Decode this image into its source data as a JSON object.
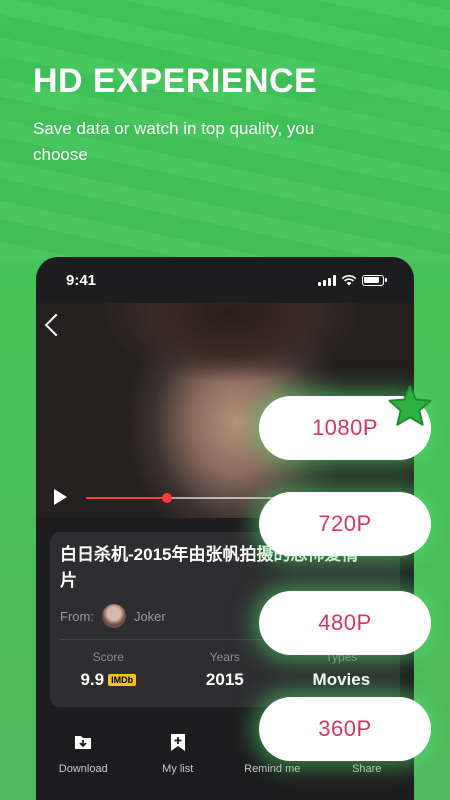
{
  "promo": {
    "headline": "HD EXPERIENCE",
    "subline": "Save data or watch in top quality, you choose"
  },
  "status_bar": {
    "time": "9:41"
  },
  "player": {
    "progress": 0.27
  },
  "movie": {
    "title": "白日杀机-2015年由张帆拍摄的恐怖爱情片",
    "from_label": "From:",
    "uploader": "Joker",
    "stats": [
      {
        "label": "Score",
        "value": "9.9",
        "badge": "IMDb"
      },
      {
        "label": "Years",
        "value": "2015"
      },
      {
        "label": "Types",
        "value": "Movies"
      }
    ]
  },
  "actions": [
    {
      "label": "Download",
      "icon": "download-icon"
    },
    {
      "label": "My list",
      "icon": "bookmark-add-icon"
    },
    {
      "label": "Remind me",
      "icon": "bell-icon"
    },
    {
      "label": "Share",
      "icon": "share-icon"
    }
  ],
  "quality_options": [
    "1080P",
    "720P",
    "480P",
    "360P"
  ],
  "colors": {
    "accent": "#d6365c",
    "brand_green": "#3fc65a",
    "progress": "#ff3b3b"
  }
}
